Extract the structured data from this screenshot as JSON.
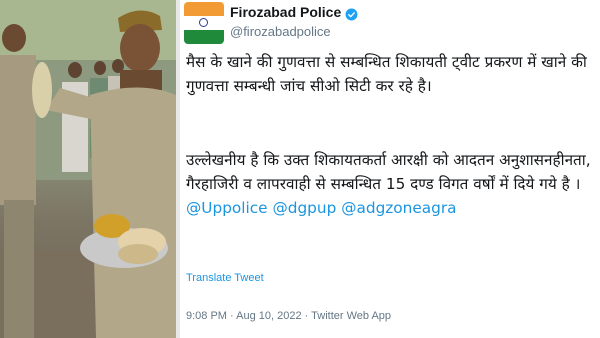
{
  "tweet": {
    "display_name": "Firozabad Police",
    "handle": "@firozabadpolice",
    "paragraph1": "मैस के खाने की गुणवत्ता से सम्बन्धित शिकायती ट्वीट प्रकरण में खाने की गुणवत्ता सम्बन्धी जांच सीओ सिटी कर रहे है।",
    "paragraph2_text": "उल्लेखनीय है कि उक्त शिकायतकर्ता आरक्षी को आदतन अनुशासनहीनता, गैरहाजिरी व लापरवाही से सम्बन्धित 15 दण्ड विगत वर्षों में दिये गये है ।",
    "mentions": [
      "@Uppolice",
      "@dgpup",
      "@adgzoneagra"
    ],
    "translate_label": "Translate Tweet",
    "timestamp": "9:08 PM · Aug 10, 2022 · Twitter Web App"
  },
  "colors": {
    "text": "#14171a",
    "secondary": "#657786",
    "link": "#1b95e0",
    "verified": "#1da1f2"
  },
  "icons": {
    "verified": "verified-badge-icon",
    "avatar": "indian-flag-avatar"
  }
}
